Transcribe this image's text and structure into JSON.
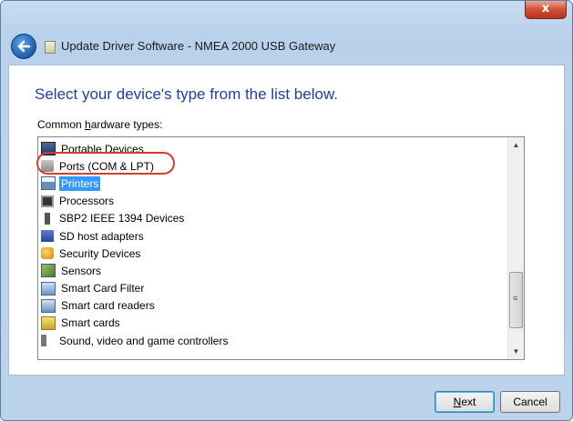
{
  "window": {
    "title": "Update Driver Software - NMEA 2000 USB Gateway",
    "close_label": "x"
  },
  "content": {
    "heading": "Select your device's type from the list below.",
    "label_pre": "Common ",
    "label_accel": "h",
    "label_post": "ardware types:"
  },
  "list": {
    "items": [
      {
        "label": "Portable Devices",
        "icon": "portable-devices-icon"
      },
      {
        "label": "Ports (COM & LPT)",
        "icon": "port-connector-icon"
      },
      {
        "label": "Printers",
        "icon": "printer-icon",
        "selected": true
      },
      {
        "label": "Processors",
        "icon": "processor-icon"
      },
      {
        "label": "SBP2 IEEE 1394 Devices",
        "icon": "firewire-icon"
      },
      {
        "label": "SD host adapters",
        "icon": "sd-adapter-icon"
      },
      {
        "label": "Security Devices",
        "icon": "security-device-icon"
      },
      {
        "label": "Sensors",
        "icon": "sensor-icon"
      },
      {
        "label": "Smart Card Filter",
        "icon": "smart-card-icon"
      },
      {
        "label": "Smart card readers",
        "icon": "smart-card-reader-icon"
      },
      {
        "label": "Smart cards",
        "icon": "smart-cards-icon"
      },
      {
        "label": "Sound, video and game controllers",
        "icon": "speaker-icon"
      }
    ],
    "scroll_up": "▲",
    "scroll_down": "▼",
    "thumb_grip": "≡"
  },
  "buttons": {
    "next_accel": "N",
    "next_rest": "ext",
    "cancel": "Cancel"
  },
  "colors": {
    "heading": "#1e3f9a",
    "selection": "#3399ff",
    "highlight_circle": "#d93a2e"
  }
}
